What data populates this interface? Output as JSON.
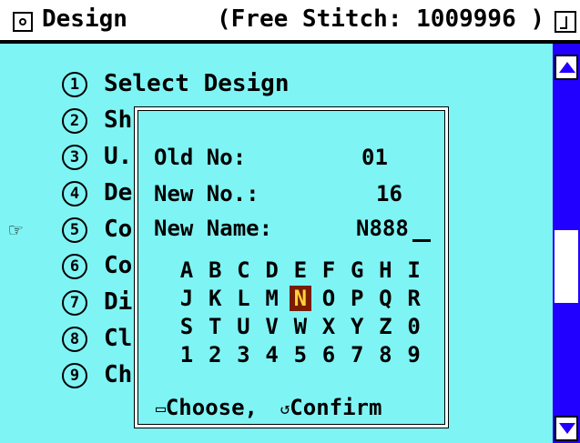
{
  "title": {
    "text": "Design",
    "info": "(Free Stitch: 1009996 )"
  },
  "menu": {
    "items": [
      {
        "num": "1",
        "label": "Select Design"
      },
      {
        "num": "2",
        "label": "Sh"
      },
      {
        "num": "3",
        "label": "U."
      },
      {
        "num": "4",
        "label": "De"
      },
      {
        "num": "5",
        "label": "Co"
      },
      {
        "num": "6",
        "label": "Co"
      },
      {
        "num": "7",
        "label": "Di"
      },
      {
        "num": "8",
        "label": "Cl"
      },
      {
        "num": "9",
        "label": "Ch"
      }
    ],
    "pointer_icon": "hand-pointer-icon"
  },
  "dialog": {
    "old_no_label": "Old No:",
    "old_no_value": "01",
    "new_no_label": "New No.:",
    "new_no_value": "16",
    "new_name_label": "New Name:",
    "new_name_value": "N888",
    "keyboard_rows": [
      [
        "A",
        "B",
        "C",
        "D",
        "E",
        "F",
        "G",
        "H",
        "I"
      ],
      [
        "J",
        "K",
        "L",
        "M",
        "N",
        "O",
        "P",
        "Q",
        "R"
      ],
      [
        "S",
        "T",
        "U",
        "V",
        "W",
        "X",
        "Y",
        "Z",
        "0"
      ],
      [
        "1",
        "2",
        "3",
        "4",
        "5",
        "6",
        "7",
        "8",
        "9"
      ]
    ],
    "selected_key": "N",
    "hint_choose": "Choose,",
    "hint_confirm": "Confirm"
  },
  "colors": {
    "background": "#7ff4f4",
    "scrollbar": "#2200ff",
    "selected_key_bg": "#7a1c00",
    "selected_key_fg": "#ffd33a"
  }
}
